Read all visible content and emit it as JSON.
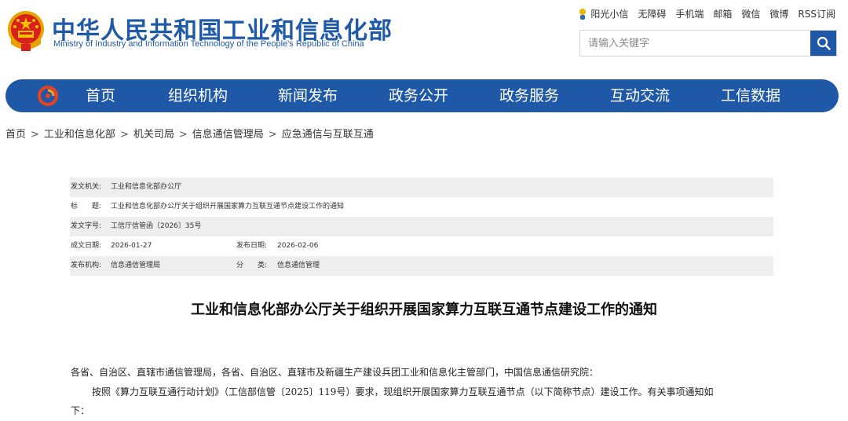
{
  "header": {
    "title": "中华人民共和国工业和信息化部",
    "subtitle": "Ministry of Industry and Information Technology of the People's Republic of China",
    "top_links": [
      "阳光小信",
      "无障碍",
      "手机端",
      "邮箱",
      "微信",
      "微博",
      "RSS订阅"
    ],
    "search": {
      "placeholder": "请输入关键字",
      "icon": "search-icon"
    }
  },
  "nav": {
    "items": [
      "首页",
      "组织机构",
      "新闻发布",
      "政务公开",
      "政务服务",
      "互动交流",
      "工信数据"
    ]
  },
  "breadcrumb": [
    "首页",
    "工业和信息化部",
    "机关司局",
    "信息通信管理局",
    "应急通信与互联互通"
  ],
  "meta": {
    "issuer_label": "发文机关:",
    "issuer": "工业和信息化部办公厅",
    "title_label": "标　　题:",
    "title": "工业和信息化部办公厅关于组织开展国家算力互联互通节点建设工作的通知",
    "doc_no_label": "发文字号:",
    "doc_no": "工信厅信管函〔2026〕35号",
    "created_label": "成文日期:",
    "created": "2026-01-27",
    "published_label": "发布日期:",
    "published": "2026-02-06",
    "org_label": "发布机构:",
    "org": "信息通信管理局",
    "category_label": "分　　类:",
    "category": "信息通信管理"
  },
  "article": {
    "title": "工业和信息化部办公厅关于组织开展国家算力互联互通节点建设工作的通知",
    "recipients": "各省、自治区、直辖市通信管理局，各省、自治区、直辖市及新疆生产建设兵团工业和信息化主管部门，中国信息通信研究院：",
    "body_line1": "按照《算力互联互通行动计划》（工信部信管〔2025〕119号）要求，现组织开展国家算力互联互通节点（以下简称节点）建设工作。有关事项通知如",
    "body_line2": "下："
  },
  "colors": {
    "brand_blue": "#1f58a6",
    "meta_gray": "#eeeeee",
    "emblem_red": "#d8201c",
    "emblem_gold": "#f2c200"
  }
}
